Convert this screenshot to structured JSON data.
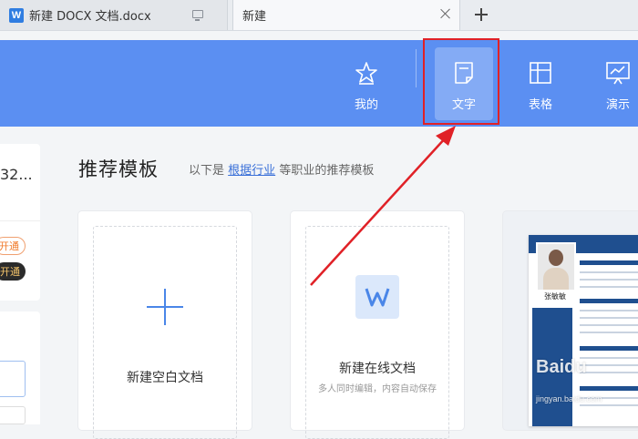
{
  "tabs": [
    {
      "label": "新建 DOCX 文档.docx",
      "icon": "W"
    },
    {
      "label": "新建"
    }
  ],
  "header": {
    "nav": [
      {
        "label": "我的",
        "icon": "star-icon"
      },
      {
        "label": "文字",
        "icon": "document-icon",
        "active": true
      },
      {
        "label": "表格",
        "icon": "table-icon"
      },
      {
        "label": "演示",
        "icon": "presentation-icon"
      }
    ]
  },
  "left_panel": {
    "partial_number": "32...",
    "pill1": "开通",
    "pill2": "开通"
  },
  "main": {
    "section_title": "推荐模板",
    "hint_prefix": "以下是",
    "hint_link": "根据行业",
    "hint_suffix": "等职业的推荐模板",
    "cards": [
      {
        "label": "新建空白文档"
      },
      {
        "label": "新建在线文档",
        "sub": "多人同时编辑，内容自动保存",
        "icon": "W"
      },
      {
        "resume_name": "张敏敏"
      }
    ]
  },
  "watermark": {
    "text": "Baidu",
    "sub": "jingyan.baidu.com"
  },
  "colors": {
    "header_blue": "#5b8ff2",
    "accent": "#4a86e8",
    "highlight_red": "#e02127"
  }
}
